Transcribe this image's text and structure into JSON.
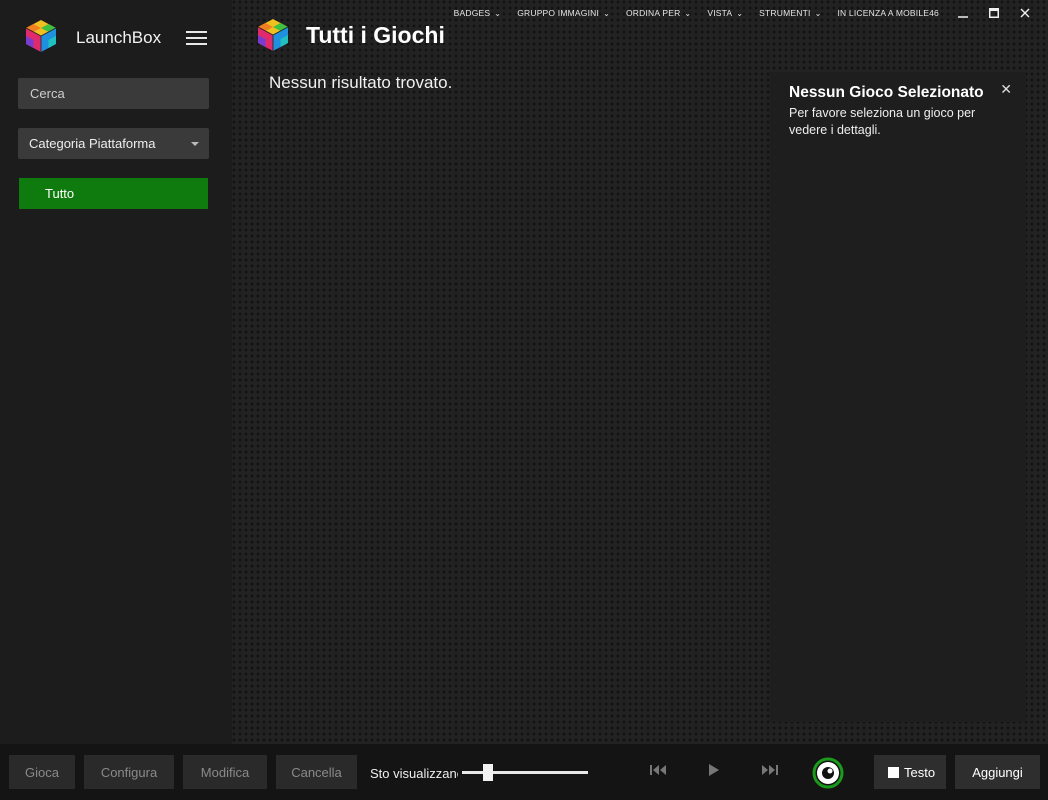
{
  "sidebar": {
    "brand": "LaunchBox",
    "search_placeholder": "Cerca",
    "category_dropdown": "Categoria Piattaforma",
    "items": [
      {
        "label": "Tutto"
      }
    ]
  },
  "menubar": {
    "items": [
      {
        "label": "BADGES"
      },
      {
        "label": "GRUPPO IMMAGINI"
      },
      {
        "label": "ORDINA PER"
      },
      {
        "label": "VISTA"
      },
      {
        "label": "STRUMENTI"
      }
    ],
    "license": "IN LICENZA A MOBILE46"
  },
  "main": {
    "title": "Tutti i Giochi",
    "empty_message": "Nessun risultato trovato."
  },
  "details": {
    "title": "Nessun Gioco Selezionato",
    "text": "Per favore seleziona un gioco per vedere i dettagli."
  },
  "bottombar": {
    "buttons": [
      "Gioca",
      "Configura",
      "Modifica",
      "Cancella"
    ],
    "zoom_label": "Sto visualizzanc",
    "zoom_level": 0.18,
    "testo_label": "Testo",
    "add_label": "Aggiungi"
  },
  "colors": {
    "accent_green": "#0f7b0f",
    "background": "#1a1a1a"
  }
}
